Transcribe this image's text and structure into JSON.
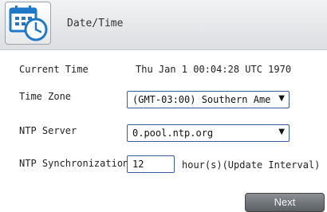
{
  "header": {
    "title": "Date/Time",
    "icon": "calendar-clock-icon"
  },
  "current_time": {
    "label": "Current Time",
    "value": "Thu Jan 1 00:04:28 UTC 1970"
  },
  "time_zone": {
    "label": "Time Zone",
    "selected": "(GMT-03:00) Southern Ame"
  },
  "ntp_server": {
    "label": "NTP Server",
    "selected": "0.pool.ntp.org"
  },
  "ntp_sync": {
    "label": "NTP Synchronization",
    "value": "12",
    "unit": "hour(s)(Update Interval)"
  },
  "next_button": {
    "label": "Next"
  },
  "colors": {
    "accent_blue": "#1f78c8",
    "field_border": "#3b5a9b",
    "button": "#6b6f73"
  }
}
